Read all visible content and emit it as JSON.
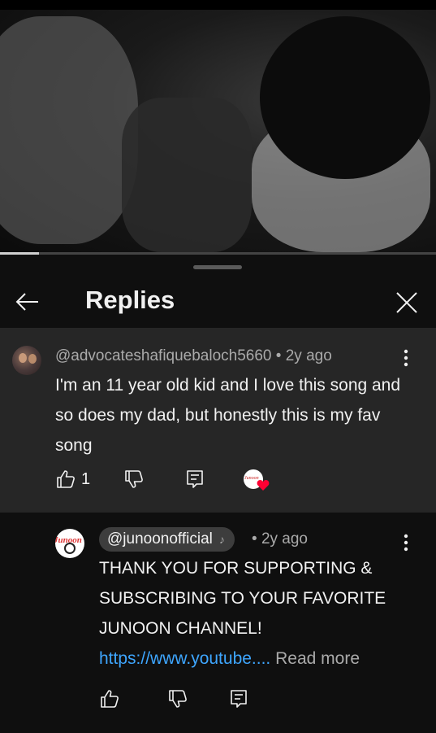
{
  "video": {
    "progress_fraction": 0.09
  },
  "header": {
    "title": "Replies"
  },
  "comment": {
    "author": "@advocateshafiquebaloch5660",
    "separator": " • ",
    "time": "2y ago",
    "text": "I'm an 11 year old kid and I love this song and so does my dad, but honestly this is my fav song",
    "like_count": "1"
  },
  "reply": {
    "author": "@junoonofficial",
    "note_icon": "♪",
    "separator": "• ",
    "time": "2y ago",
    "text": "THANK YOU FOR SUPPORTING & SUBSCRIBING TO YOUR FAVORITE JUNOON CHANNEL! ",
    "link": "https://www.youtube....",
    "read_more": " Read more"
  },
  "avatars": {
    "creator_logo_text": "Junoon"
  },
  "colors": {
    "background": "#0f0f0f",
    "comment_bg": "#262626",
    "link": "#3ea6ff",
    "heart": "#ff0033",
    "muted_text": "#aaaaaa"
  }
}
